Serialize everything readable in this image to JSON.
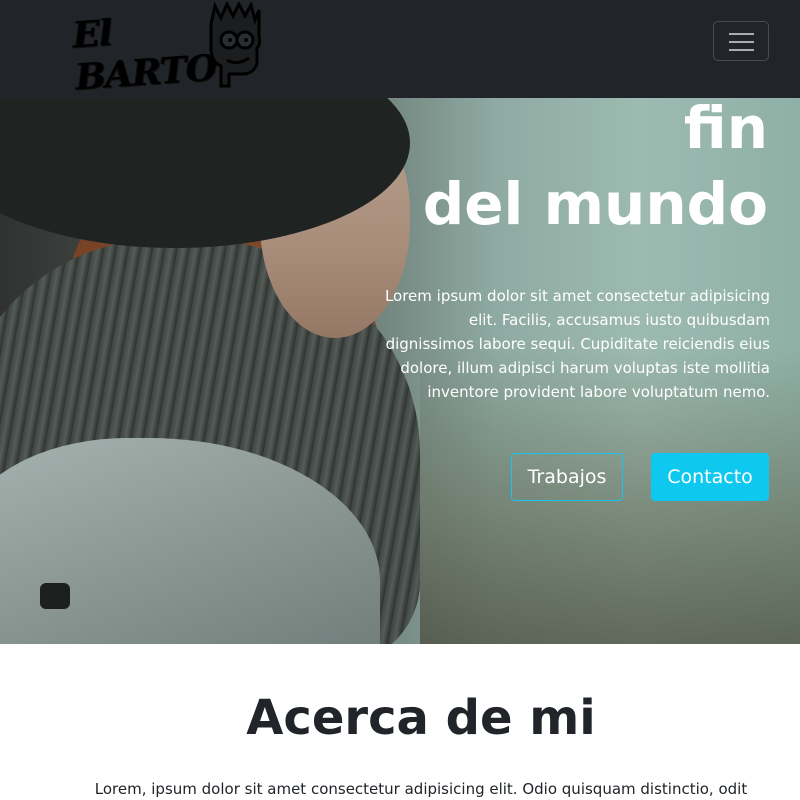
{
  "navbar": {
    "logo_text": "El BARTO",
    "logo_icon": "bart-face-icon",
    "toggler_icon": "hamburger-menu-icon"
  },
  "hero": {
    "title_line1": "fin",
    "title_line2": "del mundo",
    "paragraph": "Lorem ipsum dolor sit amet consectetur adipisicing elit. Facilis, accusamus iusto quibusdam dignissimos labore sequi. Cupiditate reiciendis eius dolore, illum adipisci harum voluptas iste mollitia inventore provident labore voluptatum nemo.",
    "button_works": "Trabajos",
    "button_contact": "Contacto"
  },
  "about": {
    "title": "Acerca de mi",
    "paragraph": "Lorem, ipsum dolor sit amet consectetur adipisicing elit. Odio quisquam distinctio, odit"
  },
  "colors": {
    "navbar_bg": "#212529",
    "accent": "#0fc8f0"
  }
}
